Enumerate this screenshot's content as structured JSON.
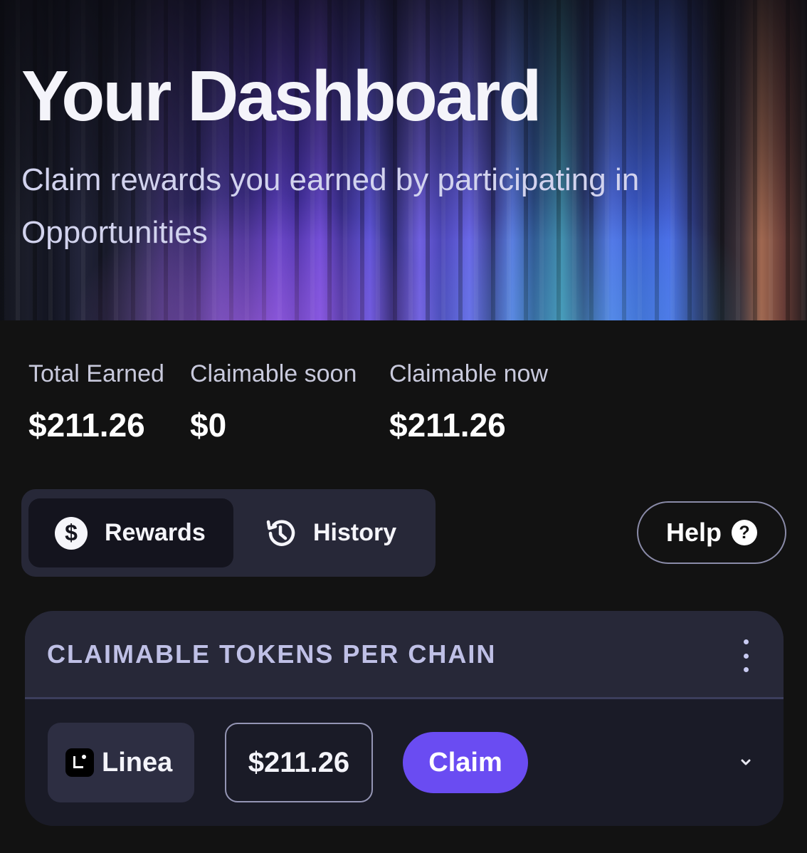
{
  "hero": {
    "title": "Your Dashboard",
    "subtitle": "Claim rewards you earned by participating in Opportunities"
  },
  "stats": [
    {
      "label": "Total Earned",
      "value": "$211.26"
    },
    {
      "label": "Claimable soon",
      "value": "$0"
    },
    {
      "label": "Claimable now",
      "value": "$211.26"
    }
  ],
  "tabs": {
    "rewards": {
      "label": "Rewards",
      "icon": "dollar-circle-icon",
      "active": true
    },
    "history": {
      "label": "History",
      "icon": "history-clock-icon",
      "active": false
    }
  },
  "help": {
    "label": "Help",
    "icon": "question-circle-icon",
    "icon_glyph": "?"
  },
  "card": {
    "title": "CLAIMABLE TOKENS PER CHAIN",
    "rows": [
      {
        "chain": "Linea",
        "chain_icon": "linea-logo-icon",
        "amount": "$211.26",
        "action": "Claim"
      }
    ]
  },
  "colors": {
    "background": "#121212",
    "accent": "#6a4cf2",
    "panel": "#272838",
    "card": "#1a1b27"
  }
}
